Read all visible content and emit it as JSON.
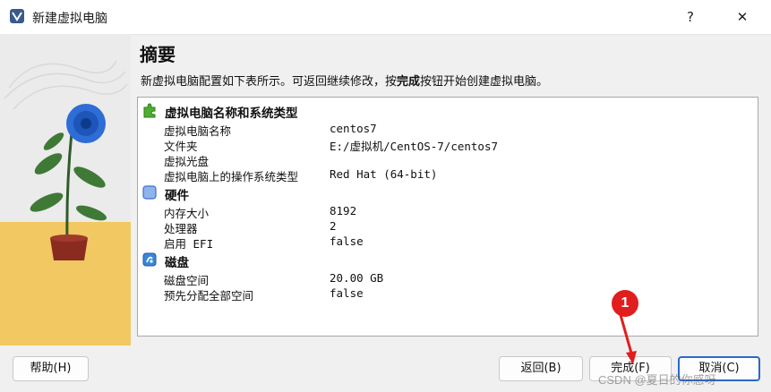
{
  "window": {
    "title": "新建虚拟电脑",
    "help_glyph": "?",
    "close_glyph": "✕",
    "app_icon": "virtualbox-icon"
  },
  "header": {
    "heading": "摘要",
    "desc_prefix": "新虚拟电脑配置如下表所示。可返回继续修改，按",
    "desc_bold": "完成",
    "desc_suffix": "按钮开始创建虚拟电脑。"
  },
  "summary": {
    "sections": [
      {
        "title": "虚拟电脑名称和系统类型",
        "icon": "green-puzzle-icon",
        "rows": [
          {
            "key": "虚拟电脑名称",
            "value": "centos7"
          },
          {
            "key": "文件夹",
            "value": "E:/虚拟机/CentOS-7/centos7"
          },
          {
            "key": "虚拟光盘",
            "value": ""
          },
          {
            "key": "虚拟电脑上的操作系统类型",
            "value": "Red Hat (64-bit)"
          }
        ]
      },
      {
        "title": "硬件",
        "icon": "blue-square-icon",
        "rows": [
          {
            "key": "内存大小",
            "value": "8192"
          },
          {
            "key": "处理器",
            "value": "2"
          },
          {
            "key": "启用 EFI",
            "value": "false"
          }
        ]
      },
      {
        "title": "磁盘",
        "icon": "disk-icon",
        "rows": [
          {
            "key": "磁盘空间",
            "value": "20.00 GB"
          },
          {
            "key": "预先分配全部空间",
            "value": "false"
          }
        ]
      }
    ]
  },
  "buttons": {
    "help": "帮助(H)",
    "back": "返回(B)",
    "finish": "完成(F)",
    "cancel": "取消(C)"
  },
  "annotation": {
    "badge": "1"
  },
  "watermark": "CSDN @夏日的你感呀",
  "colors": {
    "accent": "#2b68c8",
    "badge": "#e11d1d",
    "art_bg_top": "#ebebeb",
    "art_bg_bottom": "#f2c862"
  }
}
